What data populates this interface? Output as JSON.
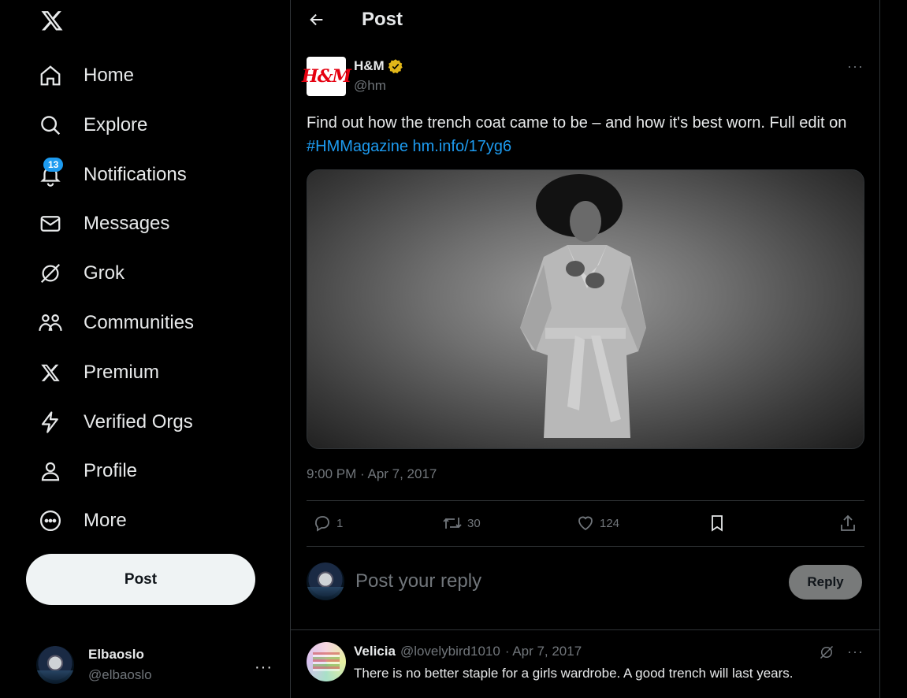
{
  "sidebar": {
    "logo_icon": "x-logo-icon",
    "items": [
      {
        "label": "Home",
        "icon": "home-icon"
      },
      {
        "label": "Explore",
        "icon": "search-icon"
      },
      {
        "label": "Notifications",
        "icon": "bell-icon",
        "badge": "13"
      },
      {
        "label": "Messages",
        "icon": "envelope-icon"
      },
      {
        "label": "Grok",
        "icon": "grok-icon"
      },
      {
        "label": "Communities",
        "icon": "communities-icon"
      },
      {
        "label": "Premium",
        "icon": "x-logo-icon"
      },
      {
        "label": "Verified Orgs",
        "icon": "lightning-icon"
      },
      {
        "label": "Profile",
        "icon": "person-icon"
      },
      {
        "label": "More",
        "icon": "more-circle-icon"
      }
    ],
    "post_button": "Post",
    "account": {
      "name": "Elbaoslo",
      "handle": "@elbaoslo",
      "more": "···"
    }
  },
  "header": {
    "title": "Post"
  },
  "tweet": {
    "avatar_text": "H&M",
    "author_name": "H&M",
    "author_handle": "@hm",
    "verified_color": "#e2b719",
    "text_plain": "Find out how the trench coat came to be – and how it's best worn. Full edit on ",
    "hashtag": "#HMMagazine",
    "link": "hm.info/17yg6",
    "timestamp": "9:00 PM · Apr 7, 2017",
    "stats": {
      "replies": "1",
      "reposts": "30",
      "likes": "124"
    },
    "more": "···"
  },
  "reply_box": {
    "placeholder": "Post your reply",
    "button": "Reply"
  },
  "replies": [
    {
      "name": "Velicia",
      "handle": "@lovelybird1010",
      "date": "· Apr 7, 2017",
      "text": "There is no better staple for a girls wardrobe. A good trench will last years.",
      "more": "···"
    }
  ],
  "colors": {
    "accent": "#1d9bf0",
    "background": "#000000",
    "text": "#e7e9ea",
    "muted": "#71767b",
    "border": "#2f3336"
  }
}
